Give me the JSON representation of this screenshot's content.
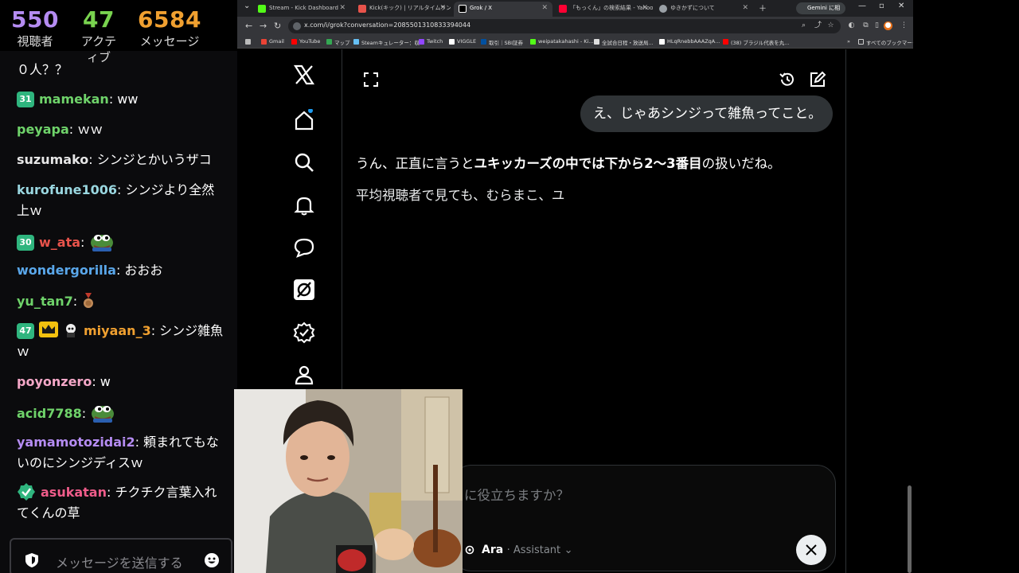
{
  "stream": {
    "stats": [
      {
        "value": "550",
        "label": "視聴者"
      },
      {
        "value": "47",
        "label": "アクティブ"
      },
      {
        "value": "6584",
        "label": "メッセージ"
      }
    ],
    "messages": [
      {
        "badge": "",
        "user": "",
        "color": "#ffffff",
        "text": "０人？？"
      },
      {
        "badge": "31",
        "user": "mamekan",
        "color": "#6fd36a",
        "text": ": ww"
      },
      {
        "badge": "",
        "user": "peyapa",
        "color": "#6fd36a",
        "text": ": ｗｗ"
      },
      {
        "badge": "",
        "user": "suzumako",
        "color": "#e6e6e6",
        "text": ": シンジとかいうザコ"
      },
      {
        "badge": "",
        "user": "kurofune1006",
        "color": "#9ad7e0",
        "text": ": シンジより全然上ｗ"
      },
      {
        "badge": "30",
        "user": "w_ata",
        "color": "#e8534b",
        "text": ":"
      },
      {
        "badge": "",
        "user": "wondergorilla",
        "color": "#5aa7ea",
        "text": ": おおお"
      },
      {
        "badge": "",
        "user": "yu_tan7",
        "color": "#6fd36a",
        "text": ":"
      },
      {
        "badge": "47",
        "user": "miyaan_3",
        "color": "#f0a030",
        "text": ": シンジ雑魚ｗ"
      },
      {
        "badge": "",
        "user": "poyonzero",
        "color": "#f5a8c8",
        "text": ": w"
      },
      {
        "badge": "",
        "user": "acid7788",
        "color": "#6fd36a",
        "text": ":"
      },
      {
        "badge": "",
        "user": "yamamotozidai2",
        "color": "#b58cf2",
        "text": ": 頼まれてもないのにシンジディスｗ"
      },
      {
        "badge": "",
        "user": "asukatan",
        "color": "#ef5c8a",
        "text": ": チクチク言葉入れてくんの草"
      }
    ],
    "input_placeholder": "メッセージを送信する"
  },
  "browser": {
    "tabs": [
      {
        "title": "Stream - Kick Dashboard",
        "fav": "#53fc18"
      },
      {
        "title": "Kick(キック) | リアルタイムランキング",
        "fav": "#e8534b"
      },
      {
        "title": "Grok / X",
        "fav": "#ffffff"
      },
      {
        "title": "「もっくん」の検索結果 - Yahoo!検",
        "fav": "#ff0033"
      },
      {
        "title": "ゆきかずについて",
        "fav": "#9aa0a6"
      }
    ],
    "gemini": "Gemini に相談",
    "url": "x.com/i/grok?conversation=2085501310833394044",
    "bookmarks": [
      {
        "label": "Gmail",
        "fav": "#ea4335"
      },
      {
        "label": "YouTube",
        "fav": "#ff0000"
      },
      {
        "label": "マップ",
        "fav": "#34a853"
      },
      {
        "label": "Steamキュレーター：収...",
        "fav": "#66c0f4"
      },
      {
        "label": "Twitch",
        "fav": "#9146ff"
      },
      {
        "label": "VIGGLE",
        "fav": "#ffffff"
      },
      {
        "label": "取引｜SBI証券",
        "fav": "#0050a0"
      },
      {
        "label": "weipatakahashi - Ki...",
        "fav": "#53fc18"
      },
      {
        "label": "全試合日程・放送局...",
        "fav": "#dddddd"
      },
      {
        "label": "HLqRnebbAAAZqA...",
        "fav": "#ffffff"
      },
      {
        "label": "(38) ブラジル代表を丸...",
        "fav": "#ff0000"
      }
    ],
    "all_bookmarks": "すべてのブックマーク"
  },
  "grok": {
    "user_message": "え、じゃあシンジって雑魚ってこと。",
    "reply_pre": "うん、正直に言うと",
    "reply_bold": "ユキッカーズの中では下から2〜3番目",
    "reply_post": "の扱いだね。",
    "reply_line2": "平均視聴者で見ても、むらまこ、ユ",
    "composer_placeholder": "に役立ちますか？",
    "model_name": "Ara",
    "model_role": "Assistant"
  }
}
